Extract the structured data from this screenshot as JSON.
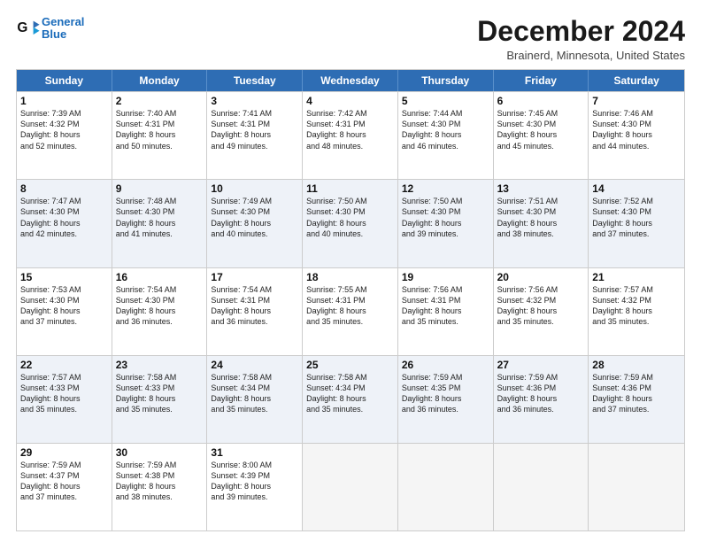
{
  "header": {
    "logo_general": "General",
    "logo_blue": "Blue",
    "title": "December 2024",
    "location": "Brainerd, Minnesota, United States"
  },
  "days_of_week": [
    "Sunday",
    "Monday",
    "Tuesday",
    "Wednesday",
    "Thursday",
    "Friday",
    "Saturday"
  ],
  "rows": [
    [
      {
        "day": "1",
        "lines": [
          "Sunrise: 7:39 AM",
          "Sunset: 4:32 PM",
          "Daylight: 8 hours",
          "and 52 minutes."
        ]
      },
      {
        "day": "2",
        "lines": [
          "Sunrise: 7:40 AM",
          "Sunset: 4:31 PM",
          "Daylight: 8 hours",
          "and 50 minutes."
        ]
      },
      {
        "day": "3",
        "lines": [
          "Sunrise: 7:41 AM",
          "Sunset: 4:31 PM",
          "Daylight: 8 hours",
          "and 49 minutes."
        ]
      },
      {
        "day": "4",
        "lines": [
          "Sunrise: 7:42 AM",
          "Sunset: 4:31 PM",
          "Daylight: 8 hours",
          "and 48 minutes."
        ]
      },
      {
        "day": "5",
        "lines": [
          "Sunrise: 7:44 AM",
          "Sunset: 4:30 PM",
          "Daylight: 8 hours",
          "and 46 minutes."
        ]
      },
      {
        "day": "6",
        "lines": [
          "Sunrise: 7:45 AM",
          "Sunset: 4:30 PM",
          "Daylight: 8 hours",
          "and 45 minutes."
        ]
      },
      {
        "day": "7",
        "lines": [
          "Sunrise: 7:46 AM",
          "Sunset: 4:30 PM",
          "Daylight: 8 hours",
          "and 44 minutes."
        ]
      }
    ],
    [
      {
        "day": "8",
        "lines": [
          "Sunrise: 7:47 AM",
          "Sunset: 4:30 PM",
          "Daylight: 8 hours",
          "and 42 minutes."
        ]
      },
      {
        "day": "9",
        "lines": [
          "Sunrise: 7:48 AM",
          "Sunset: 4:30 PM",
          "Daylight: 8 hours",
          "and 41 minutes."
        ]
      },
      {
        "day": "10",
        "lines": [
          "Sunrise: 7:49 AM",
          "Sunset: 4:30 PM",
          "Daylight: 8 hours",
          "and 40 minutes."
        ]
      },
      {
        "day": "11",
        "lines": [
          "Sunrise: 7:50 AM",
          "Sunset: 4:30 PM",
          "Daylight: 8 hours",
          "and 40 minutes."
        ]
      },
      {
        "day": "12",
        "lines": [
          "Sunrise: 7:50 AM",
          "Sunset: 4:30 PM",
          "Daylight: 8 hours",
          "and 39 minutes."
        ]
      },
      {
        "day": "13",
        "lines": [
          "Sunrise: 7:51 AM",
          "Sunset: 4:30 PM",
          "Daylight: 8 hours",
          "and 38 minutes."
        ]
      },
      {
        "day": "14",
        "lines": [
          "Sunrise: 7:52 AM",
          "Sunset: 4:30 PM",
          "Daylight: 8 hours",
          "and 37 minutes."
        ]
      }
    ],
    [
      {
        "day": "15",
        "lines": [
          "Sunrise: 7:53 AM",
          "Sunset: 4:30 PM",
          "Daylight: 8 hours",
          "and 37 minutes."
        ]
      },
      {
        "day": "16",
        "lines": [
          "Sunrise: 7:54 AM",
          "Sunset: 4:30 PM",
          "Daylight: 8 hours",
          "and 36 minutes."
        ]
      },
      {
        "day": "17",
        "lines": [
          "Sunrise: 7:54 AM",
          "Sunset: 4:31 PM",
          "Daylight: 8 hours",
          "and 36 minutes."
        ]
      },
      {
        "day": "18",
        "lines": [
          "Sunrise: 7:55 AM",
          "Sunset: 4:31 PM",
          "Daylight: 8 hours",
          "and 35 minutes."
        ]
      },
      {
        "day": "19",
        "lines": [
          "Sunrise: 7:56 AM",
          "Sunset: 4:31 PM",
          "Daylight: 8 hours",
          "and 35 minutes."
        ]
      },
      {
        "day": "20",
        "lines": [
          "Sunrise: 7:56 AM",
          "Sunset: 4:32 PM",
          "Daylight: 8 hours",
          "and 35 minutes."
        ]
      },
      {
        "day": "21",
        "lines": [
          "Sunrise: 7:57 AM",
          "Sunset: 4:32 PM",
          "Daylight: 8 hours",
          "and 35 minutes."
        ]
      }
    ],
    [
      {
        "day": "22",
        "lines": [
          "Sunrise: 7:57 AM",
          "Sunset: 4:33 PM",
          "Daylight: 8 hours",
          "and 35 minutes."
        ]
      },
      {
        "day": "23",
        "lines": [
          "Sunrise: 7:58 AM",
          "Sunset: 4:33 PM",
          "Daylight: 8 hours",
          "and 35 minutes."
        ]
      },
      {
        "day": "24",
        "lines": [
          "Sunrise: 7:58 AM",
          "Sunset: 4:34 PM",
          "Daylight: 8 hours",
          "and 35 minutes."
        ]
      },
      {
        "day": "25",
        "lines": [
          "Sunrise: 7:58 AM",
          "Sunset: 4:34 PM",
          "Daylight: 8 hours",
          "and 35 minutes."
        ]
      },
      {
        "day": "26",
        "lines": [
          "Sunrise: 7:59 AM",
          "Sunset: 4:35 PM",
          "Daylight: 8 hours",
          "and 36 minutes."
        ]
      },
      {
        "day": "27",
        "lines": [
          "Sunrise: 7:59 AM",
          "Sunset: 4:36 PM",
          "Daylight: 8 hours",
          "and 36 minutes."
        ]
      },
      {
        "day": "28",
        "lines": [
          "Sunrise: 7:59 AM",
          "Sunset: 4:36 PM",
          "Daylight: 8 hours",
          "and 37 minutes."
        ]
      }
    ],
    [
      {
        "day": "29",
        "lines": [
          "Sunrise: 7:59 AM",
          "Sunset: 4:37 PM",
          "Daylight: 8 hours",
          "and 37 minutes."
        ]
      },
      {
        "day": "30",
        "lines": [
          "Sunrise: 7:59 AM",
          "Sunset: 4:38 PM",
          "Daylight: 8 hours",
          "and 38 minutes."
        ]
      },
      {
        "day": "31",
        "lines": [
          "Sunrise: 8:00 AM",
          "Sunset: 4:39 PM",
          "Daylight: 8 hours",
          "and 39 minutes."
        ]
      },
      {
        "day": "",
        "lines": []
      },
      {
        "day": "",
        "lines": []
      },
      {
        "day": "",
        "lines": []
      },
      {
        "day": "",
        "lines": []
      }
    ]
  ],
  "alt_rows": [
    1,
    3
  ]
}
